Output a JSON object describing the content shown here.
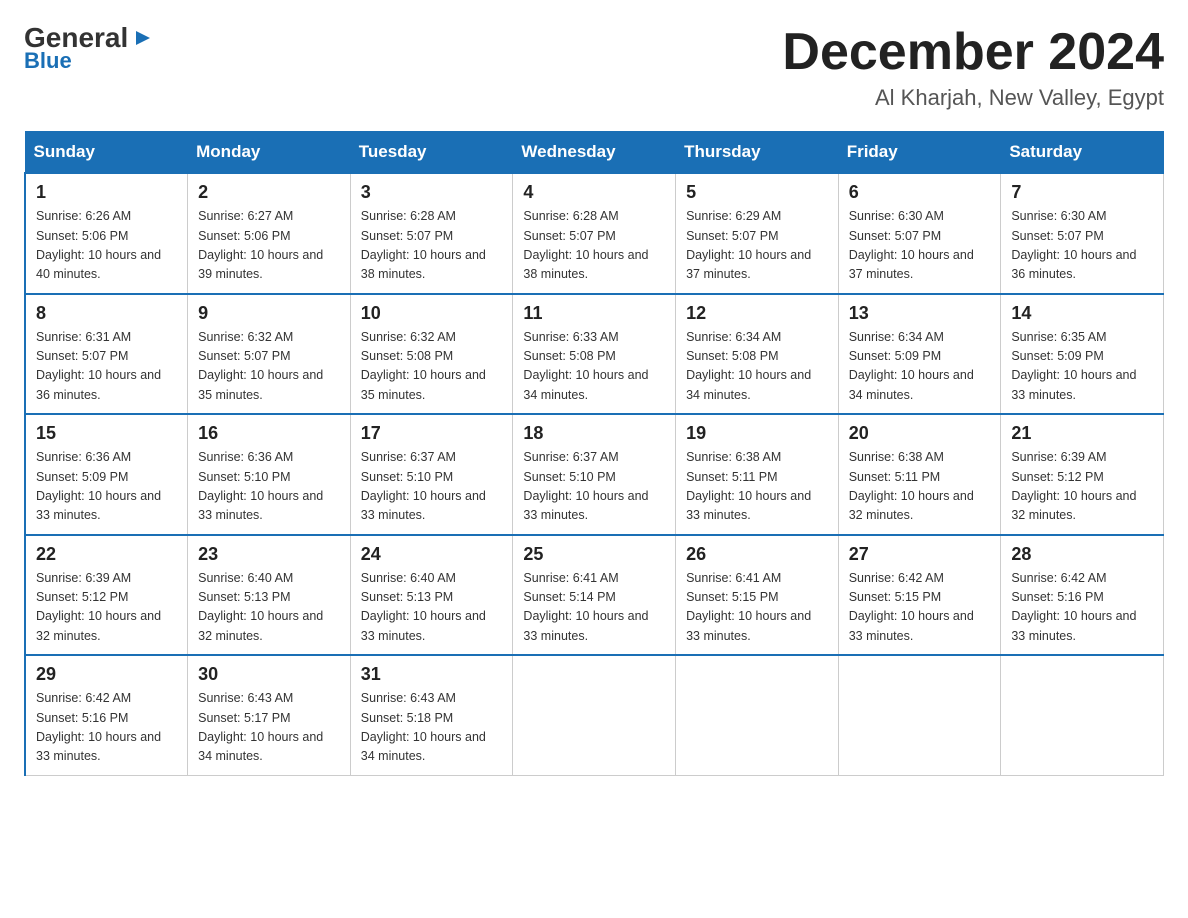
{
  "logo": {
    "general": "General",
    "blue": "Blue",
    "arrow_unicode": "▶"
  },
  "title": "December 2024",
  "location": "Al Kharjah, New Valley, Egypt",
  "days_of_week": [
    "Sunday",
    "Monday",
    "Tuesday",
    "Wednesday",
    "Thursday",
    "Friday",
    "Saturday"
  ],
  "weeks": [
    [
      {
        "day": "1",
        "sunrise": "6:26 AM",
        "sunset": "5:06 PM",
        "daylight": "10 hours and 40 minutes."
      },
      {
        "day": "2",
        "sunrise": "6:27 AM",
        "sunset": "5:06 PM",
        "daylight": "10 hours and 39 minutes."
      },
      {
        "day": "3",
        "sunrise": "6:28 AM",
        "sunset": "5:07 PM",
        "daylight": "10 hours and 38 minutes."
      },
      {
        "day": "4",
        "sunrise": "6:28 AM",
        "sunset": "5:07 PM",
        "daylight": "10 hours and 38 minutes."
      },
      {
        "day": "5",
        "sunrise": "6:29 AM",
        "sunset": "5:07 PM",
        "daylight": "10 hours and 37 minutes."
      },
      {
        "day": "6",
        "sunrise": "6:30 AM",
        "sunset": "5:07 PM",
        "daylight": "10 hours and 37 minutes."
      },
      {
        "day": "7",
        "sunrise": "6:30 AM",
        "sunset": "5:07 PM",
        "daylight": "10 hours and 36 minutes."
      }
    ],
    [
      {
        "day": "8",
        "sunrise": "6:31 AM",
        "sunset": "5:07 PM",
        "daylight": "10 hours and 36 minutes."
      },
      {
        "day": "9",
        "sunrise": "6:32 AM",
        "sunset": "5:07 PM",
        "daylight": "10 hours and 35 minutes."
      },
      {
        "day": "10",
        "sunrise": "6:32 AM",
        "sunset": "5:08 PM",
        "daylight": "10 hours and 35 minutes."
      },
      {
        "day": "11",
        "sunrise": "6:33 AM",
        "sunset": "5:08 PM",
        "daylight": "10 hours and 34 minutes."
      },
      {
        "day": "12",
        "sunrise": "6:34 AM",
        "sunset": "5:08 PM",
        "daylight": "10 hours and 34 minutes."
      },
      {
        "day": "13",
        "sunrise": "6:34 AM",
        "sunset": "5:09 PM",
        "daylight": "10 hours and 34 minutes."
      },
      {
        "day": "14",
        "sunrise": "6:35 AM",
        "sunset": "5:09 PM",
        "daylight": "10 hours and 33 minutes."
      }
    ],
    [
      {
        "day": "15",
        "sunrise": "6:36 AM",
        "sunset": "5:09 PM",
        "daylight": "10 hours and 33 minutes."
      },
      {
        "day": "16",
        "sunrise": "6:36 AM",
        "sunset": "5:10 PM",
        "daylight": "10 hours and 33 minutes."
      },
      {
        "day": "17",
        "sunrise": "6:37 AM",
        "sunset": "5:10 PM",
        "daylight": "10 hours and 33 minutes."
      },
      {
        "day": "18",
        "sunrise": "6:37 AM",
        "sunset": "5:10 PM",
        "daylight": "10 hours and 33 minutes."
      },
      {
        "day": "19",
        "sunrise": "6:38 AM",
        "sunset": "5:11 PM",
        "daylight": "10 hours and 33 minutes."
      },
      {
        "day": "20",
        "sunrise": "6:38 AM",
        "sunset": "5:11 PM",
        "daylight": "10 hours and 32 minutes."
      },
      {
        "day": "21",
        "sunrise": "6:39 AM",
        "sunset": "5:12 PM",
        "daylight": "10 hours and 32 minutes."
      }
    ],
    [
      {
        "day": "22",
        "sunrise": "6:39 AM",
        "sunset": "5:12 PM",
        "daylight": "10 hours and 32 minutes."
      },
      {
        "day": "23",
        "sunrise": "6:40 AM",
        "sunset": "5:13 PM",
        "daylight": "10 hours and 32 minutes."
      },
      {
        "day": "24",
        "sunrise": "6:40 AM",
        "sunset": "5:13 PM",
        "daylight": "10 hours and 33 minutes."
      },
      {
        "day": "25",
        "sunrise": "6:41 AM",
        "sunset": "5:14 PM",
        "daylight": "10 hours and 33 minutes."
      },
      {
        "day": "26",
        "sunrise": "6:41 AM",
        "sunset": "5:15 PM",
        "daylight": "10 hours and 33 minutes."
      },
      {
        "day": "27",
        "sunrise": "6:42 AM",
        "sunset": "5:15 PM",
        "daylight": "10 hours and 33 minutes."
      },
      {
        "day": "28",
        "sunrise": "6:42 AM",
        "sunset": "5:16 PM",
        "daylight": "10 hours and 33 minutes."
      }
    ],
    [
      {
        "day": "29",
        "sunrise": "6:42 AM",
        "sunset": "5:16 PM",
        "daylight": "10 hours and 33 minutes."
      },
      {
        "day": "30",
        "sunrise": "6:43 AM",
        "sunset": "5:17 PM",
        "daylight": "10 hours and 34 minutes."
      },
      {
        "day": "31",
        "sunrise": "6:43 AM",
        "sunset": "5:18 PM",
        "daylight": "10 hours and 34 minutes."
      },
      null,
      null,
      null,
      null
    ]
  ]
}
